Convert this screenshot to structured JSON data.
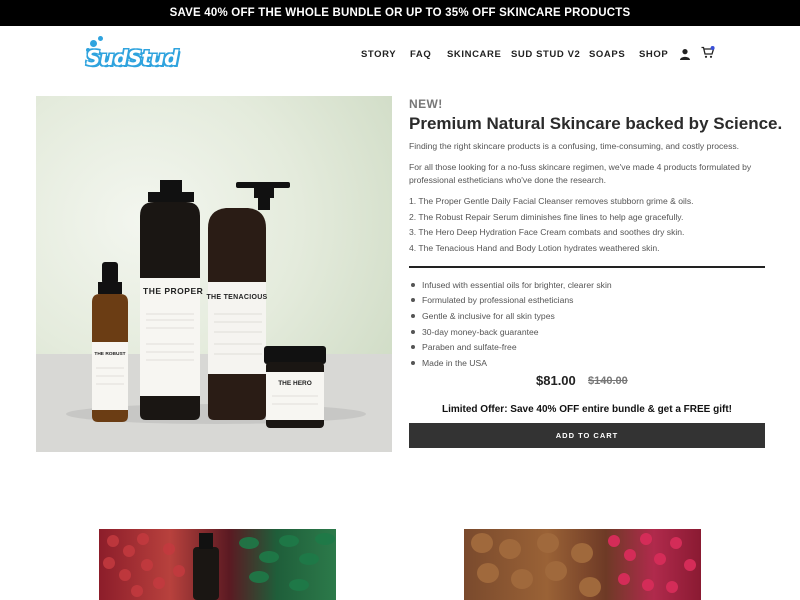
{
  "announcement": "SAVE 40% OFF THE WHOLE BUNDLE OR UP TO 35% OFF SKINCARE PRODUCTS",
  "brand": {
    "logo_text": "SudStud"
  },
  "nav": {
    "items": [
      {
        "label": "STORY"
      },
      {
        "label": "FAQ"
      },
      {
        "label": "SKINCARE"
      },
      {
        "label": "SUD STUD V2"
      },
      {
        "label": "SOAPS"
      },
      {
        "label": "SHOP"
      }
    ],
    "account_icon": "user-icon",
    "cart_icon": "cart-icon"
  },
  "product": {
    "badge": "NEW!",
    "title": "Premium Natural Skincare backed by Science.",
    "intro": "Finding the right skincare products is a confusing, time-consuming, and costly process.",
    "description": "For all those looking for a no-fuss skincare regimen, we've made 4 products formulated by professional estheticians who've done the research.",
    "steps": [
      "1. The Proper Gentle Daily Facial Cleanser removes stubborn grime & oils.",
      "2. The Robust Repair Serum diminishes fine lines to help age gracefully.",
      "3. The Hero Deep Hydration Face Cream combats and soothes dry skin.",
      "4. The Tenacious Hand and Body Lotion hydrates weathered skin."
    ],
    "features": [
      "Infused with essential oils for brighter, clearer skin",
      "Formulated by professional estheticians",
      "Gentle & inclusive for all skin types",
      "30-day money-back guarantee",
      "Paraben and sulfate-free",
      "Made in the USA"
    ],
    "price": "$81.00",
    "compare_price": "$140.00",
    "offer": "Limited Offer: Save 40% OFF entire bundle & get a FREE gift!",
    "cta": "ADD TO CART"
  },
  "image_labels": {
    "proper": "THE PROPER",
    "tenacious": "THE TENACIOUS",
    "robust": "THE ROBUST",
    "hero": "THE HERO"
  },
  "colors": {
    "brand_blue": "#2fa3de",
    "announcement_bg": "#000000",
    "button_bg": "#333333"
  }
}
